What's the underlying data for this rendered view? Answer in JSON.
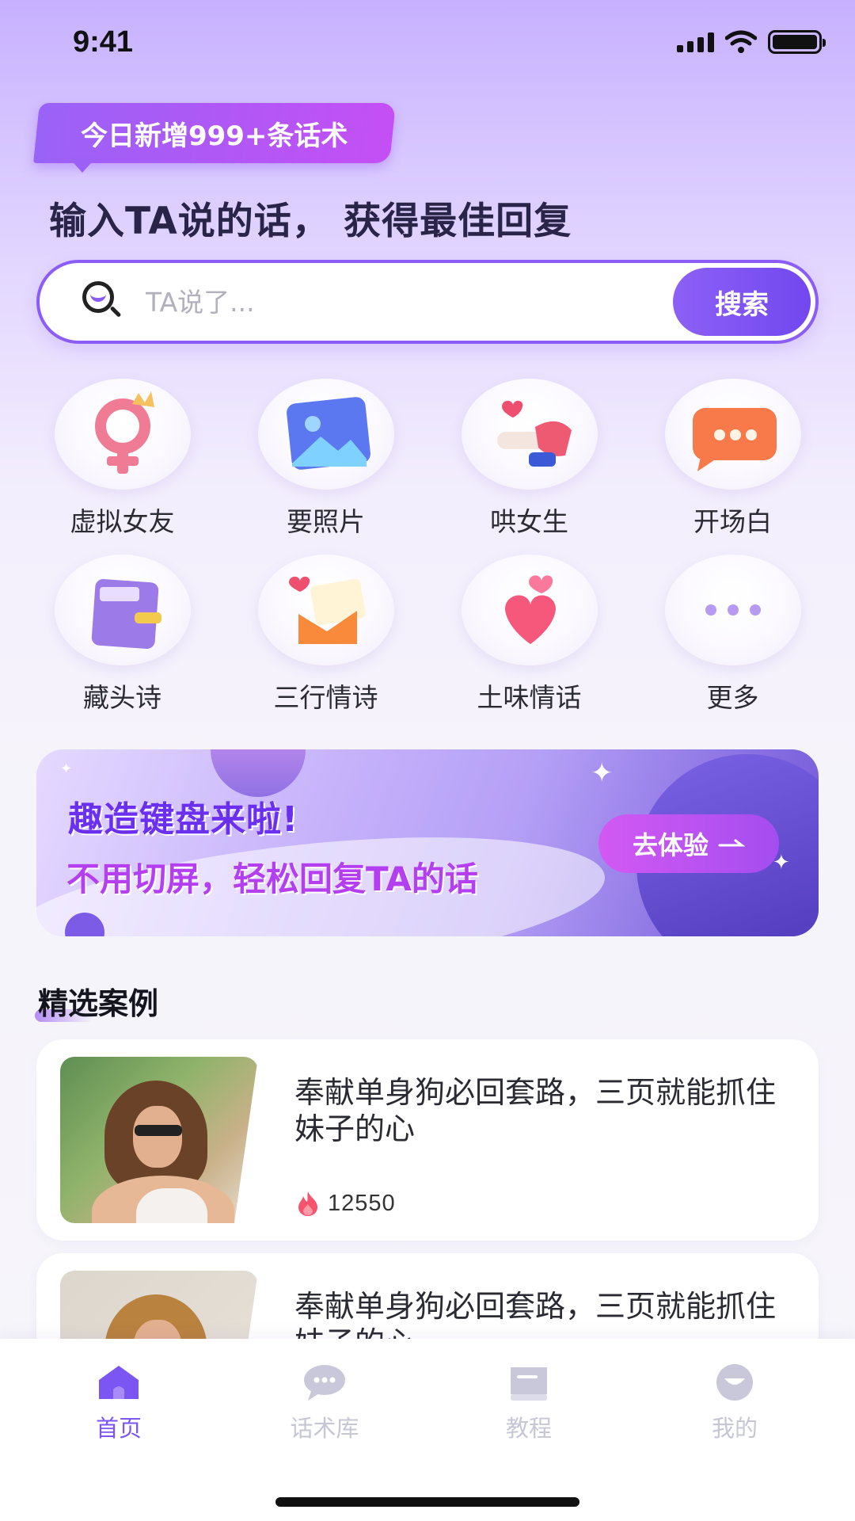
{
  "status_bar": {
    "time": "9:41"
  },
  "promo": {
    "badge": "今日新增999+条话术",
    "headline": "输入TA说的话， 获得最佳回复"
  },
  "search": {
    "placeholder": "TA说了...",
    "value": "",
    "button": "搜索"
  },
  "categories": [
    {
      "label": "虚拟女友",
      "icon": "female-symbol-crown-icon"
    },
    {
      "label": "要照片",
      "icon": "photo-icon"
    },
    {
      "label": "哄女生",
      "icon": "hand-heart-icon"
    },
    {
      "label": "开场白",
      "icon": "chat-bubble-icon"
    },
    {
      "label": "藏头诗",
      "icon": "book-icon"
    },
    {
      "label": "三行情诗",
      "icon": "love-letter-icon"
    },
    {
      "label": "土味情话",
      "icon": "hearts-icon"
    },
    {
      "label": "更多",
      "icon": "more-dots-icon"
    }
  ],
  "banner": {
    "title": "趣造键盘来啦!",
    "subtitle": "不用切屏，轻松回复TA的话",
    "button": "去体验",
    "button_icon": "arrow-right-icon"
  },
  "featured": {
    "title": "精选案例",
    "cases": [
      {
        "title": "奉献单身狗必回套路，三页就能抓住妹子的心",
        "views": "12550",
        "icon": "fire-icon"
      },
      {
        "title": "奉献单身狗必回套路，三页就能抓住妹子的心",
        "views": "",
        "icon": "fire-icon"
      }
    ]
  },
  "tabs": [
    {
      "label": "首页",
      "icon": "home-icon",
      "active": true
    },
    {
      "label": "话术库",
      "icon": "chat-icon",
      "active": false
    },
    {
      "label": "教程",
      "icon": "book-icon",
      "active": false
    },
    {
      "label": "我的",
      "icon": "profile-icon",
      "active": false
    }
  ],
  "colors": {
    "accent": "#7b56f2",
    "badge": "#b455f5",
    "tab_inactive": "#c6c6d6"
  }
}
